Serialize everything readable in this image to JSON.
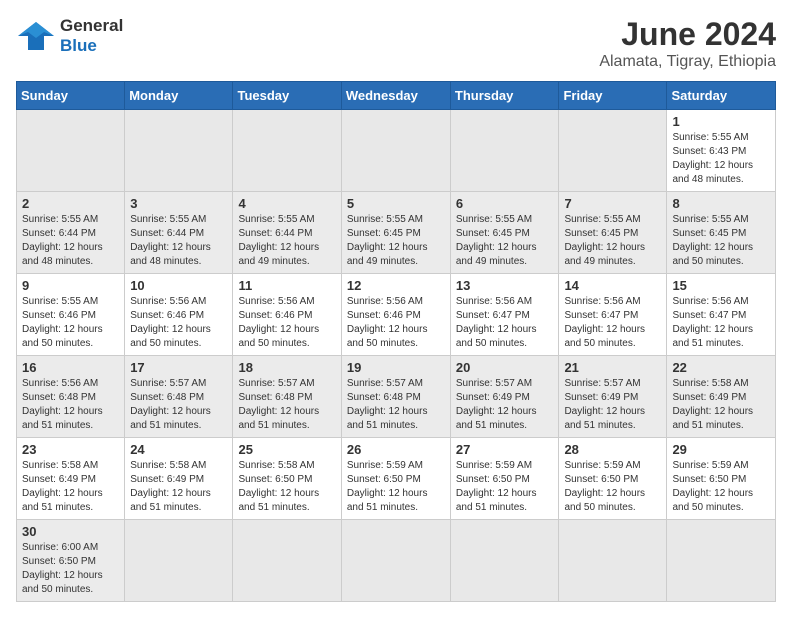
{
  "header": {
    "logo_line1": "General",
    "logo_line2": "Blue",
    "month_title": "June 2024",
    "subtitle": "Alamata, Tigray, Ethiopia"
  },
  "days_of_week": [
    "Sunday",
    "Monday",
    "Tuesday",
    "Wednesday",
    "Thursday",
    "Friday",
    "Saturday"
  ],
  "weeks": [
    [
      {
        "day": null
      },
      {
        "day": null
      },
      {
        "day": null
      },
      {
        "day": null
      },
      {
        "day": null
      },
      {
        "day": null
      },
      {
        "day": "1",
        "sunrise": "5:55 AM",
        "sunset": "6:43 PM",
        "daylight": "12 hours and 48 minutes."
      }
    ],
    [
      {
        "day": "2",
        "sunrise": "5:55 AM",
        "sunset": "6:44 PM",
        "daylight": "12 hours and 48 minutes."
      },
      {
        "day": "3",
        "sunrise": "5:55 AM",
        "sunset": "6:44 PM",
        "daylight": "12 hours and 48 minutes."
      },
      {
        "day": "4",
        "sunrise": "5:55 AM",
        "sunset": "6:44 PM",
        "daylight": "12 hours and 49 minutes."
      },
      {
        "day": "5",
        "sunrise": "5:55 AM",
        "sunset": "6:45 PM",
        "daylight": "12 hours and 49 minutes."
      },
      {
        "day": "6",
        "sunrise": "5:55 AM",
        "sunset": "6:45 PM",
        "daylight": "12 hours and 49 minutes."
      },
      {
        "day": "7",
        "sunrise": "5:55 AM",
        "sunset": "6:45 PM",
        "daylight": "12 hours and 49 minutes."
      },
      {
        "day": "8",
        "sunrise": "5:55 AM",
        "sunset": "6:45 PM",
        "daylight": "12 hours and 50 minutes."
      }
    ],
    [
      {
        "day": "9",
        "sunrise": "5:55 AM",
        "sunset": "6:46 PM",
        "daylight": "12 hours and 50 minutes."
      },
      {
        "day": "10",
        "sunrise": "5:56 AM",
        "sunset": "6:46 PM",
        "daylight": "12 hours and 50 minutes."
      },
      {
        "day": "11",
        "sunrise": "5:56 AM",
        "sunset": "6:46 PM",
        "daylight": "12 hours and 50 minutes."
      },
      {
        "day": "12",
        "sunrise": "5:56 AM",
        "sunset": "6:46 PM",
        "daylight": "12 hours and 50 minutes."
      },
      {
        "day": "13",
        "sunrise": "5:56 AM",
        "sunset": "6:47 PM",
        "daylight": "12 hours and 50 minutes."
      },
      {
        "day": "14",
        "sunrise": "5:56 AM",
        "sunset": "6:47 PM",
        "daylight": "12 hours and 50 minutes."
      },
      {
        "day": "15",
        "sunrise": "5:56 AM",
        "sunset": "6:47 PM",
        "daylight": "12 hours and 51 minutes."
      }
    ],
    [
      {
        "day": "16",
        "sunrise": "5:56 AM",
        "sunset": "6:48 PM",
        "daylight": "12 hours and 51 minutes."
      },
      {
        "day": "17",
        "sunrise": "5:57 AM",
        "sunset": "6:48 PM",
        "daylight": "12 hours and 51 minutes."
      },
      {
        "day": "18",
        "sunrise": "5:57 AM",
        "sunset": "6:48 PM",
        "daylight": "12 hours and 51 minutes."
      },
      {
        "day": "19",
        "sunrise": "5:57 AM",
        "sunset": "6:48 PM",
        "daylight": "12 hours and 51 minutes."
      },
      {
        "day": "20",
        "sunrise": "5:57 AM",
        "sunset": "6:49 PM",
        "daylight": "12 hours and 51 minutes."
      },
      {
        "day": "21",
        "sunrise": "5:57 AM",
        "sunset": "6:49 PM",
        "daylight": "12 hours and 51 minutes."
      },
      {
        "day": "22",
        "sunrise": "5:58 AM",
        "sunset": "6:49 PM",
        "daylight": "12 hours and 51 minutes."
      }
    ],
    [
      {
        "day": "23",
        "sunrise": "5:58 AM",
        "sunset": "6:49 PM",
        "daylight": "12 hours and 51 minutes."
      },
      {
        "day": "24",
        "sunrise": "5:58 AM",
        "sunset": "6:49 PM",
        "daylight": "12 hours and 51 minutes."
      },
      {
        "day": "25",
        "sunrise": "5:58 AM",
        "sunset": "6:50 PM",
        "daylight": "12 hours and 51 minutes."
      },
      {
        "day": "26",
        "sunrise": "5:59 AM",
        "sunset": "6:50 PM",
        "daylight": "12 hours and 51 minutes."
      },
      {
        "day": "27",
        "sunrise": "5:59 AM",
        "sunset": "6:50 PM",
        "daylight": "12 hours and 51 minutes."
      },
      {
        "day": "28",
        "sunrise": "5:59 AM",
        "sunset": "6:50 PM",
        "daylight": "12 hours and 50 minutes."
      },
      {
        "day": "29",
        "sunrise": "5:59 AM",
        "sunset": "6:50 PM",
        "daylight": "12 hours and 50 minutes."
      }
    ],
    [
      {
        "day": "30",
        "sunrise": "6:00 AM",
        "sunset": "6:50 PM",
        "daylight": "12 hours and 50 minutes."
      },
      {
        "day": null
      },
      {
        "day": null
      },
      {
        "day": null
      },
      {
        "day": null
      },
      {
        "day": null
      },
      {
        "day": null
      }
    ]
  ]
}
